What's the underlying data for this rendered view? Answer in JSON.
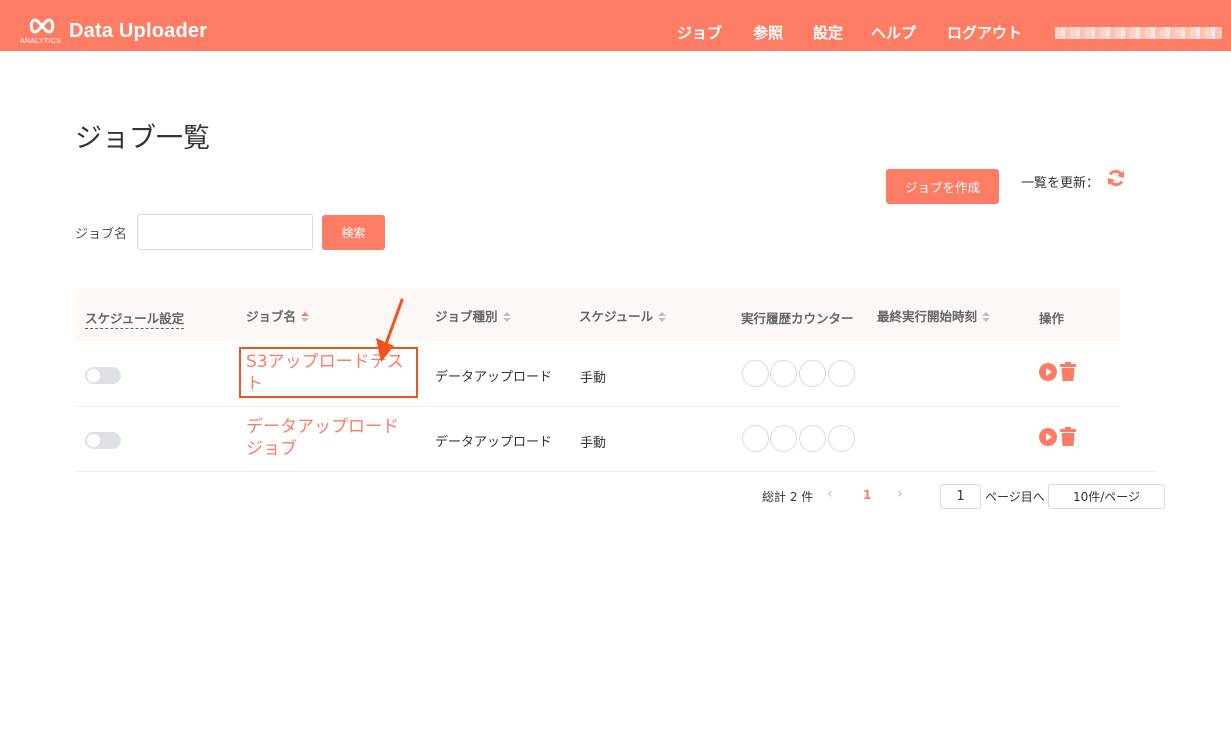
{
  "header": {
    "logo_sub": "ANALYTICS",
    "app_title": "Data Uploader",
    "nav": [
      "ジョブ",
      "参照",
      "設定",
      "ヘルプ",
      "ログアウト"
    ]
  },
  "page": {
    "title": "ジョブ一覧",
    "create_button": "ジョブを作成",
    "refresh_label": "一覧を更新：",
    "search_label": "ジョブ名",
    "search_value": "",
    "search_button": "検索"
  },
  "table": {
    "headers": [
      "スケジュール設定",
      "ジョブ名",
      "ジョブ種別",
      "スケジュール",
      "実行履歴カウンター",
      "最終実行開始時刻",
      "操作"
    ],
    "rows": [
      {
        "schedule_enabled": false,
        "name_line1": "S3アップロードテス",
        "name_line2": "ト",
        "type": "データアップロード",
        "schedule": "手動",
        "last_run": "",
        "history_counter": [
          0,
          0,
          0,
          0
        ]
      },
      {
        "schedule_enabled": false,
        "name_line1": "データアップロード",
        "name_line2": "ジョブ",
        "type": "データアップロード",
        "schedule": "手動",
        "last_run": "",
        "history_counter": [
          0,
          0,
          0,
          0
        ]
      }
    ]
  },
  "pagination": {
    "total": "総計 2 件",
    "current_page": "1",
    "goto_value": "1",
    "goto_suffix": "ページ目へ",
    "page_size": "10件/ページ"
  },
  "colors": {
    "accent": "#fd7c63",
    "highlight": "#f0531f"
  },
  "icons": [
    "analytics-logo-icon",
    "refresh-icon",
    "run-icon",
    "trash-icon",
    "chevron-left-icon",
    "chevron-right-icon",
    "annotation-arrow-icon"
  ]
}
